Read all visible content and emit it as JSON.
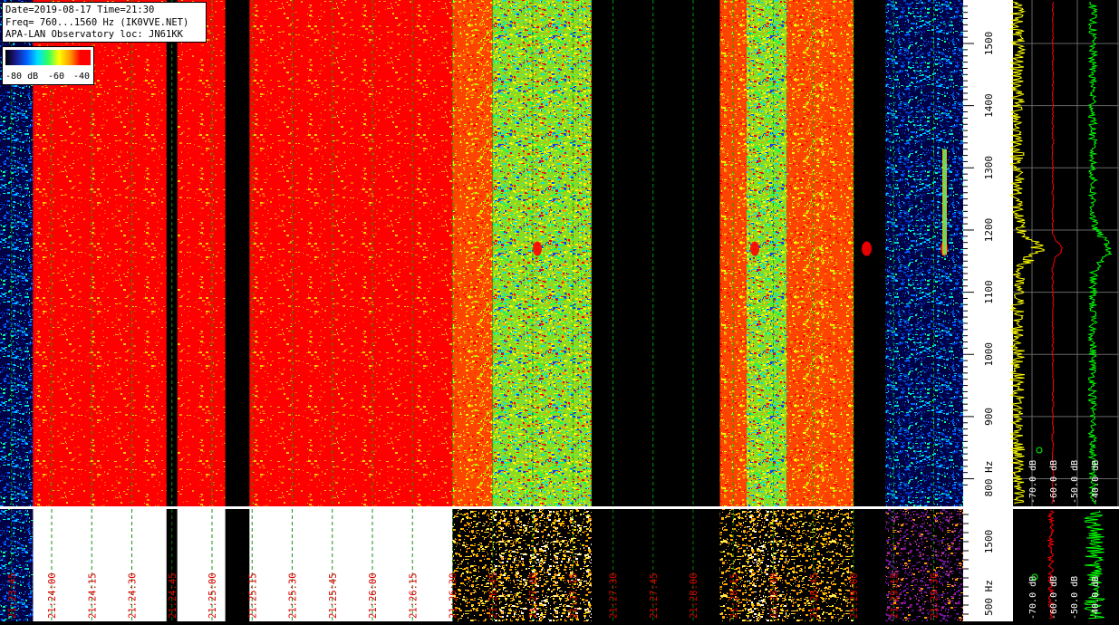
{
  "header": {
    "line1": "Date=2019-08-17 Time=21:30",
    "line2": "Freq= 760...1560 Hz (IK0VVE.NET)",
    "line3": "APA-LAN Observatory loc: JN61KK"
  },
  "legend": {
    "labels": [
      "-80 dB",
      "-60",
      "-40"
    ]
  },
  "chart_data": {
    "type": "heatmap",
    "title": "",
    "date": "2019-08-17",
    "time": "21:30",
    "frequency_range_hz": [
      760,
      1560
    ],
    "x_ticks": [
      "21:23:45",
      "21:24:00",
      "21:24:15",
      "21:24:30",
      "21:24:45",
      "21:25:00",
      "21:25:15",
      "21:25:30",
      "21:25:45",
      "21:26:00",
      "21:26:15",
      "21:26:30",
      "21:26:45",
      "21:27:00",
      "21:27:15",
      "21:27:30",
      "21:27:45",
      "21:28:00",
      "21:28:15",
      "21:28:30",
      "21:28:45",
      "21:29:00",
      "21:29:15",
      "21:29:30",
      "21:29:45"
    ],
    "y_ticks": [
      "1500",
      "1400",
      "1300",
      "1200",
      "1100",
      "1000",
      "900",
      "800 Hz"
    ],
    "y_ticks_values": [
      1500,
      1400,
      1300,
      1200,
      1100,
      1000,
      900,
      800
    ],
    "lower_y_ticks": [
      "1500",
      "500 Hz"
    ],
    "color_scale_db": [
      -80,
      -40
    ],
    "time_segments": [
      {
        "from": "21:23:40",
        "to": "21:23:53",
        "level": "low"
      },
      {
        "from": "21:23:53",
        "to": "21:24:43",
        "level": "saturated"
      },
      {
        "from": "21:24:43",
        "to": "21:24:47",
        "level": "none"
      },
      {
        "from": "21:24:47",
        "to": "21:25:05",
        "level": "saturated"
      },
      {
        "from": "21:25:05",
        "to": "21:25:14",
        "level": "none"
      },
      {
        "from": "21:25:14",
        "to": "21:26:30",
        "level": "saturated"
      },
      {
        "from": "21:26:30",
        "to": "21:26:45",
        "level": "high"
      },
      {
        "from": "21:26:45",
        "to": "21:27:22",
        "level": "medium"
      },
      {
        "from": "21:27:22",
        "to": "21:28:10",
        "level": "none"
      },
      {
        "from": "21:28:10",
        "to": "21:28:20",
        "level": "high"
      },
      {
        "from": "21:28:20",
        "to": "21:28:35",
        "level": "medium"
      },
      {
        "from": "21:28:35",
        "to": "21:29:00",
        "level": "high"
      },
      {
        "from": "21:29:00",
        "to": "21:29:12",
        "level": "none"
      },
      {
        "from": "21:29:12",
        "to": "21:29:45",
        "level": "low"
      }
    ],
    "spectrum_scale": [
      "-70.0 dB",
      "-60.0 dB",
      "-50.0 dB",
      "-40.0 dB"
    ],
    "spectrum_peak_hz": 1170,
    "series": [
      {
        "color": "#ffff00"
      },
      {
        "color": "#ff0000"
      },
      {
        "color": "#00ff00"
      }
    ]
  }
}
